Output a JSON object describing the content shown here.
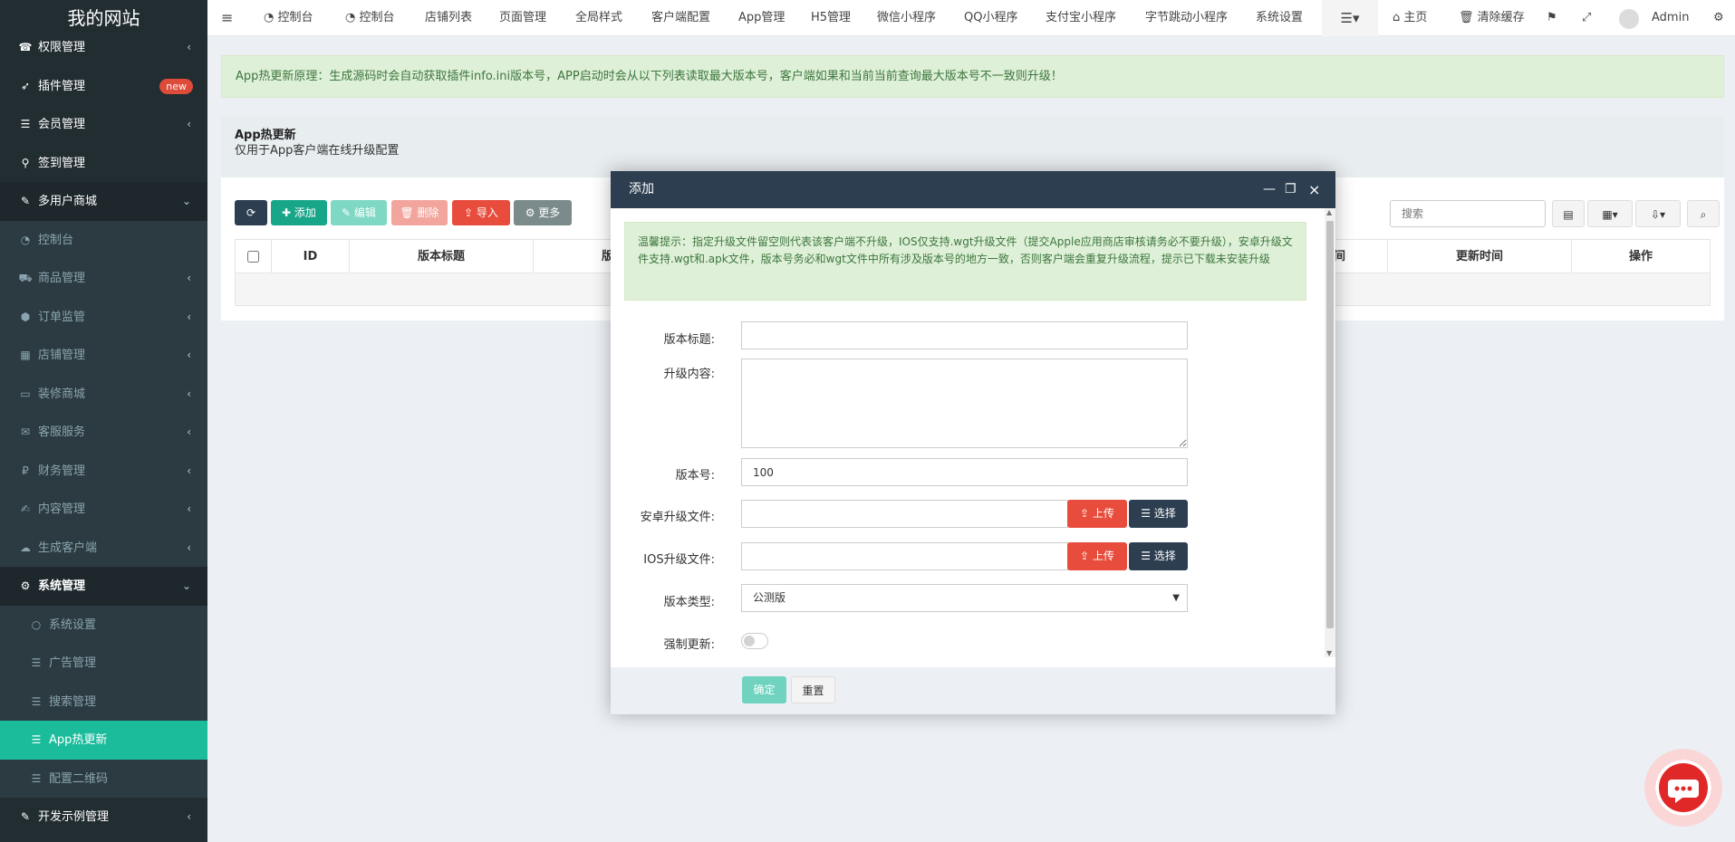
{
  "brand": "我的网站",
  "sidebar": {
    "items": [
      {
        "icon": "phone-icon",
        "label": "权限管理"
      },
      {
        "icon": "rocket-icon",
        "label": "插件管理",
        "badge": "new"
      },
      {
        "icon": "list-icon",
        "label": "会员管理"
      },
      {
        "icon": "map-pin-icon",
        "label": "签到管理"
      },
      {
        "icon": "magic-wand-icon",
        "label": "多用户商城"
      },
      {
        "icon": "dashboard-icon",
        "label": "控制台"
      },
      {
        "icon": "cart-icon",
        "label": "商品管理"
      },
      {
        "icon": "cube-icon",
        "label": "订单监管"
      },
      {
        "icon": "archive-icon",
        "label": "店铺管理"
      },
      {
        "icon": "desktop-icon",
        "label": "装修商城"
      },
      {
        "icon": "chat-icon",
        "label": "客服服务"
      },
      {
        "icon": "paypal-icon",
        "label": "财务管理"
      },
      {
        "icon": "edit-icon",
        "label": "内容管理"
      },
      {
        "icon": "cloud-icon",
        "label": "生成客户端"
      },
      {
        "icon": "gear-icon",
        "label": "系统管理"
      },
      {
        "icon": "circle-icon",
        "label": "系统设置"
      },
      {
        "icon": "list-icon",
        "label": "广告管理"
      },
      {
        "icon": "list-icon",
        "label": "搜索管理"
      },
      {
        "icon": "list-icon",
        "label": "App热更新"
      },
      {
        "icon": "list-icon",
        "label": "配置二维码"
      },
      {
        "icon": "magic-wand-icon",
        "label": "开发示例管理"
      }
    ]
  },
  "topnav": {
    "menu_icon": "≡",
    "items": [
      "控制台",
      "控制台",
      "店铺列表",
      "页面管理",
      "全局样式",
      "客户端配置",
      "App管理",
      "H5管理",
      "微信小程序",
      "QQ小程序",
      "支付宝小程序",
      "字节跳动小程序",
      "系统设置"
    ],
    "home": "主页",
    "clear_cache": "清除缓存",
    "user": "Admin"
  },
  "alert_top": "App热更新原理：生成源码时会自动获取插件info.ini版本号，APP启动时会从以下列表读取最大版本号，客户端如果和当前当前查询最大版本号不一致则升级！",
  "panel": {
    "title": "App热更新",
    "desc": "仅用于App客户端在线升级配置"
  },
  "toolbar": {
    "add": "添加",
    "edit": "编辑",
    "delete": "删除",
    "import": "导入",
    "more": "更多",
    "search_placeholder": "搜索"
  },
  "table": {
    "headers": [
      "ID",
      "版本标题",
      "版",
      "间",
      "更新时间",
      "操作"
    ]
  },
  "modal": {
    "title": "添加",
    "tip": "温馨提示：指定升级文件留空则代表该客户端不升级，IOS仅支持.wgt升级文件（提交Apple应用商店审核请务必不要升级），安卓升级文件支持.wgt和.apk文件，版本号务必和wgt文件中所有涉及版本号的地方一致，否则客户端会重复升级流程，提示已下载未安装升级",
    "fields": {
      "title_label": "版本标题:",
      "title_value": "",
      "content_label": "升级内容:",
      "content_value": "",
      "version_label": "版本号:",
      "version_value": "100",
      "android_label": "安卓升级文件:",
      "ios_label": "IOS升级文件:",
      "upload": "上传",
      "choose": "选择",
      "type_label": "版本类型:",
      "type_value": "公测版",
      "force_label": "强制更新:"
    },
    "confirm": "确定",
    "reset": "重置"
  },
  "colors": {
    "sidebar_bg": "#222d32",
    "active": "#1abc9c",
    "modal_header": "#2c3e50",
    "danger": "#e74c3c",
    "primary_dark": "#2c3e50",
    "success": "#18bc9c"
  }
}
